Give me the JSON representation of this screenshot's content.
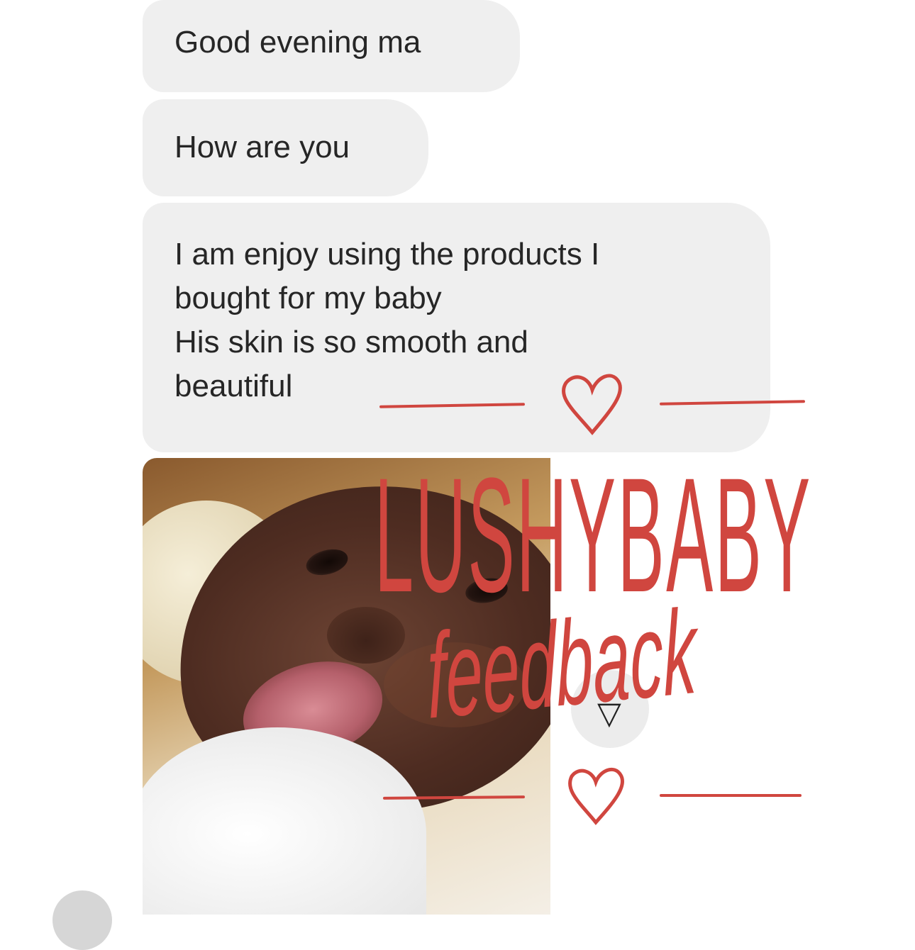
{
  "messages": [
    {
      "text": "Good evening ma"
    },
    {
      "text": "How are you"
    },
    {
      "lines": [
        "I am enjoy using the products I",
        "bought for my baby",
        "His skin is so smooth and",
        "beautiful"
      ]
    }
  ],
  "photo": {
    "subject": "baby photo"
  },
  "watermark": {
    "brand": "LUSHYBABY",
    "sub": "feedback",
    "color": "#d0463f"
  },
  "icons": {
    "heart": "heart-icon",
    "forward": "forward-arrow-icon",
    "avatar": "avatar"
  },
  "colors": {
    "bubble": "#efefef",
    "text": "#262626",
    "background": "#ffffff"
  }
}
